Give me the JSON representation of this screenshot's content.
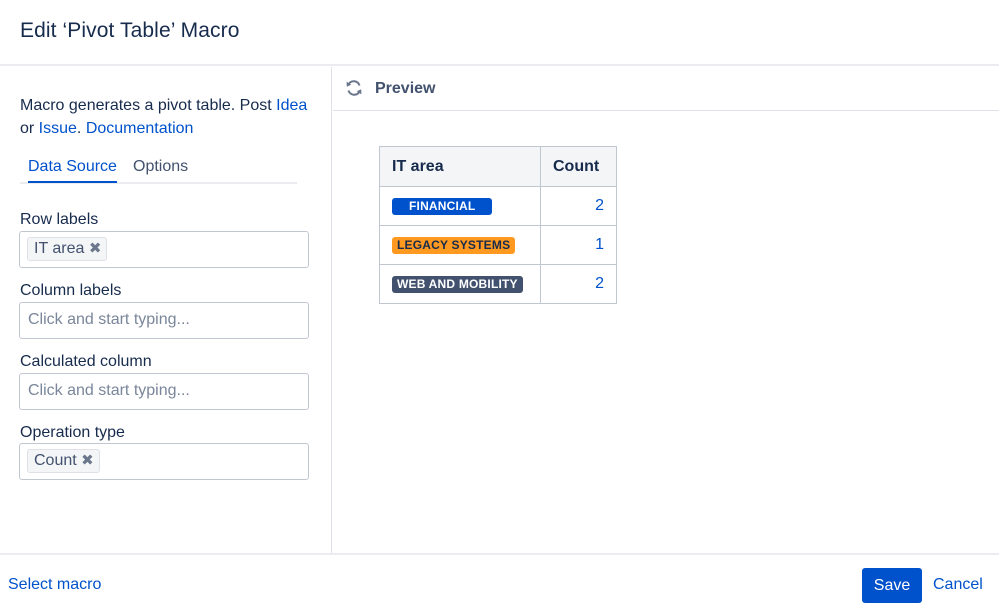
{
  "dialog": {
    "title": "Edit ‘Pivot Table’ Macro"
  },
  "description": {
    "text_before": "Macro generates a pivot table. Post ",
    "idea_link": "Idea",
    "text_or": "or ",
    "issue_link": "Issue",
    "text_dot": ". ",
    "documentation_link": "Documentation"
  },
  "tabs": [
    {
      "label": "Data Source",
      "active": true
    },
    {
      "label": "Options",
      "active": false
    }
  ],
  "fields": {
    "row_labels": {
      "label": "Row labels",
      "chip": "IT area"
    },
    "column_labels": {
      "label": "Column labels",
      "placeholder": "Click and start typing..."
    },
    "calculated_column": {
      "label": "Calculated column",
      "placeholder": "Click and start typing..."
    },
    "operation_type": {
      "label": "Operation type",
      "chip": "Count"
    }
  },
  "preview": {
    "title": "Preview",
    "refresh_icon": "refresh-icon",
    "table": {
      "headers": [
        "IT area",
        "Count"
      ],
      "rows": [
        {
          "label": "FINANCIAL",
          "count": "2",
          "color": "#0052cc",
          "text_color": "#ffffff"
        },
        {
          "label": "LEGACY SYSTEMS",
          "count": "1",
          "color": "#ff991f",
          "text_color": "#172b4d"
        },
        {
          "label": "WEB AND MOBILITY",
          "count": "2",
          "color": "#42526e",
          "text_color": "#ffffff"
        }
      ]
    }
  },
  "footer": {
    "select_macro": "Select macro",
    "save": "Save",
    "cancel": "Cancel"
  },
  "colors": {
    "accent": "#0052cc",
    "text": "#172b4d"
  }
}
